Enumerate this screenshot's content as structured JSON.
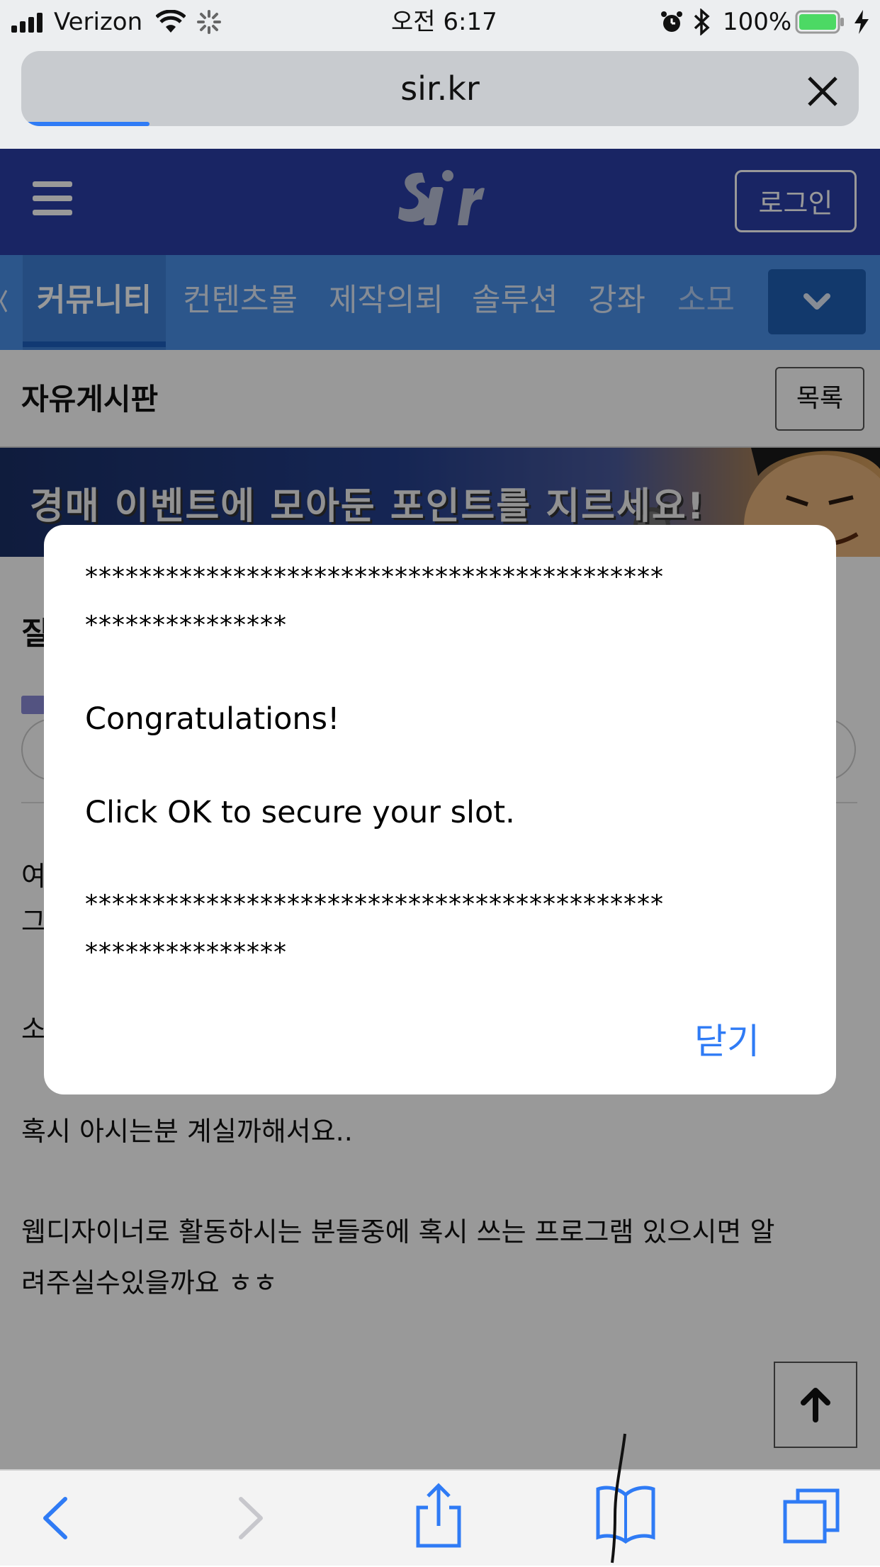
{
  "status_bar": {
    "carrier": "Verizon",
    "time": "오전 6:17",
    "battery": "100%"
  },
  "browser": {
    "url": "sir.kr",
    "load_progress": 0.15
  },
  "header": {
    "logo": "sir",
    "login_label": "로그인"
  },
  "nav": {
    "items": [
      "커뮤니티",
      "컨텐츠몰",
      "제작의뢰",
      "솔루션",
      "강좌",
      "소모"
    ]
  },
  "board": {
    "title": "자유게시판",
    "list_button": "목록"
  },
  "banner": {
    "text": "경매 이벤트에 모아둔 포인트를 지르세요!"
  },
  "post": {
    "lines": [
      "혹시 아시는분 계실까해서요..",
      "웹디자이너로 활동하시는 분들중에 혹시 쓰는 프로그램 있으시면 알",
      "려주실수있을까요 ㅎㅎ"
    ],
    "partial": [
      "질",
      "여",
      "그",
      "소"
    ]
  },
  "dialog": {
    "stars_line1": "*******************************************",
    "stars_line2": "***************",
    "message1": "Congratulations!",
    "message2": "Click OK to secure your slot.",
    "stars_line3": "*******************************************",
    "stars_line4": "***************",
    "close_label": "닫기"
  },
  "colors": {
    "header_bg": "#2b3ea7",
    "nav_bg": "#4a8fe8",
    "accent_blue": "#2f7bf5",
    "battery_green": "#4cd964"
  }
}
